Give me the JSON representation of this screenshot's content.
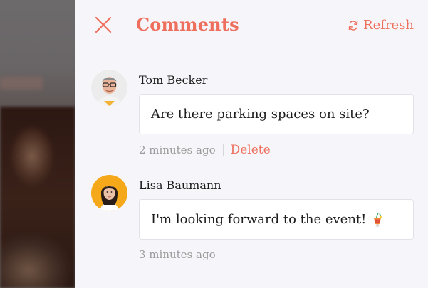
{
  "header": {
    "title": "Comments",
    "refresh_label": "Refresh",
    "close_icon": "close-icon",
    "refresh_icon": "refresh-icon"
  },
  "comments": [
    {
      "author": "Tom Becker",
      "text": "Are there parking spaces on site?",
      "time": "2 minutes ago",
      "delete_label": "Delete"
    },
    {
      "author": "Lisa Baumann",
      "text": "I'm looking forward to the event!",
      "emoji": "tropical-drink-emoji",
      "time": "3 minutes ago"
    }
  ],
  "colors": {
    "accent": "#ee6f5d",
    "panel_bg": "#f6f5f9",
    "muted_text": "#9b9b9b"
  }
}
